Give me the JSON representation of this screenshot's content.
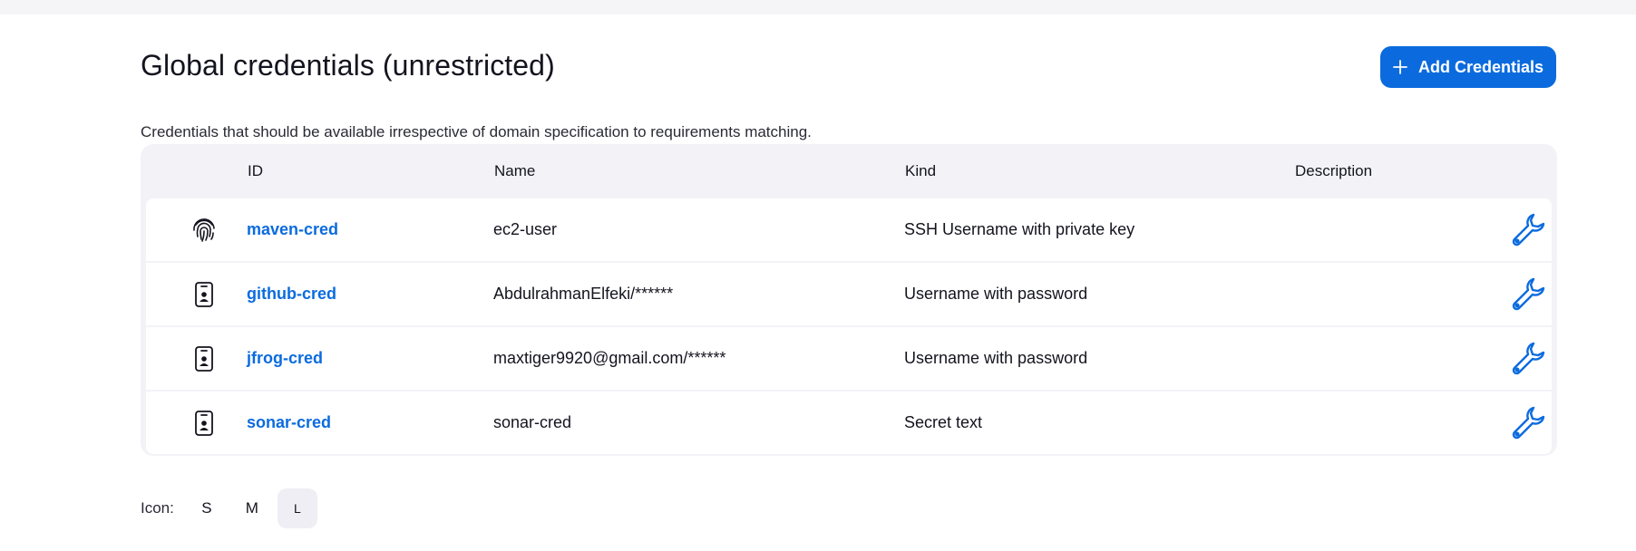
{
  "page": {
    "title": "Global credentials (unrestricted)",
    "description": "Credentials that should be available irrespective of domain specification to requirements matching.",
    "add_button_label": "Add Credentials"
  },
  "colors": {
    "accent": "#0b6bde",
    "text": "#14141f",
    "table_bg": "#f3f3f7"
  },
  "table": {
    "columns": [
      "ID",
      "Name",
      "Kind",
      "Description"
    ],
    "rows": [
      {
        "icon": "fingerprint-icon",
        "id": "maven-cred",
        "name": "ec2-user",
        "kind": "SSH Username with private key",
        "description": ""
      },
      {
        "icon": "id-badge-icon",
        "id": "github-cred",
        "name": "AbdulrahmanElfeki/******",
        "kind": "Username with password",
        "description": ""
      },
      {
        "icon": "id-badge-icon",
        "id": "jfrog-cred",
        "name": "maxtiger9920@gmail.com/******",
        "kind": "Username with password",
        "description": ""
      },
      {
        "icon": "id-badge-icon",
        "id": "sonar-cred",
        "name": "sonar-cred",
        "kind": "Secret text",
        "description": ""
      }
    ]
  },
  "icon_size": {
    "label": "Icon:",
    "options": [
      "S",
      "M",
      "L"
    ],
    "selected": "L"
  }
}
